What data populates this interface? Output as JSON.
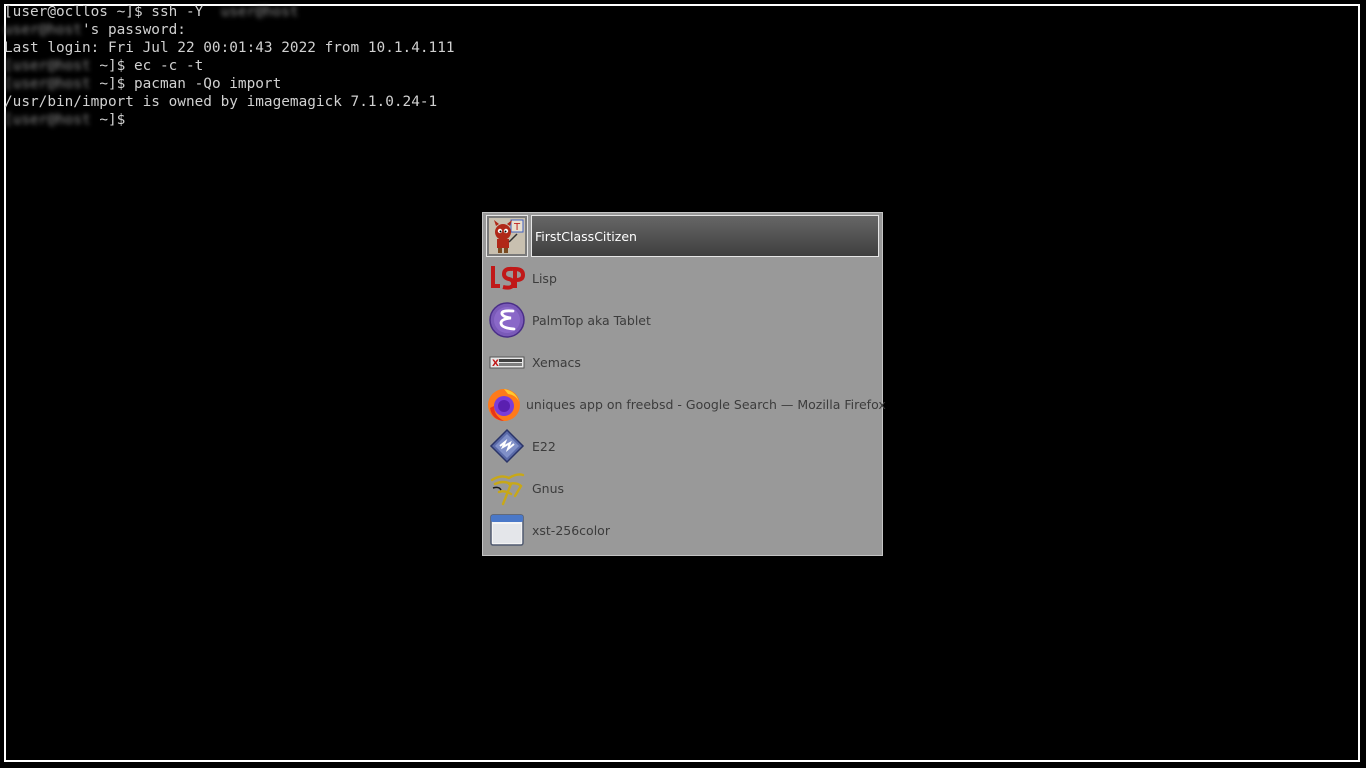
{
  "terminal": {
    "lines": [
      {
        "prefix": "[user@ocllos ~]$ ssh -Y",
        "blurred": "  user@host  ",
        "suffix": ""
      },
      {
        "prefix": "",
        "blurred": "user@host",
        "suffix": "'s password:"
      },
      {
        "prefix": "Last login: Fri Jul 22 00:01:43 2022 from 10.1.4.111",
        "blurred": "",
        "suffix": ""
      },
      {
        "prefix": "",
        "blurred": "[user@host ",
        "suffix": "~]$ ec -c -t"
      },
      {
        "prefix": "",
        "blurred": "[user@host ",
        "suffix": "~]$ pacman -Qo import"
      },
      {
        "prefix": "/usr/bin/import is owned by imagemagick 7.1.0.24-1",
        "blurred": "",
        "suffix": ""
      },
      {
        "prefix": "",
        "blurred": "[user@host ",
        "suffix": "~]$"
      }
    ]
  },
  "switcher": {
    "items": [
      {
        "label": "FirstClassCitizen",
        "icon": "freebsd-daemon-icon",
        "selected": true
      },
      {
        "label": "Lisp",
        "icon": "lisp-icon"
      },
      {
        "label": "PalmTop aka Tablet",
        "icon": "emacs-icon"
      },
      {
        "label": "Xemacs",
        "icon": "xemacs-icon"
      },
      {
        "label": "uniques app on freebsd - Google Search — Mozilla Firefox",
        "icon": "firefox-icon"
      },
      {
        "label": "E22",
        "icon": "e22-editor-icon"
      },
      {
        "label": "Gnus",
        "icon": "gnus-icon"
      },
      {
        "label": "xst-256color",
        "icon": "terminal-window-icon"
      }
    ]
  },
  "colors": {
    "terminal_bg": "#000000",
    "terminal_fg": "#d0d0d0",
    "switcher_bg": "#999999",
    "selected_bg": "#4a4a4a"
  }
}
